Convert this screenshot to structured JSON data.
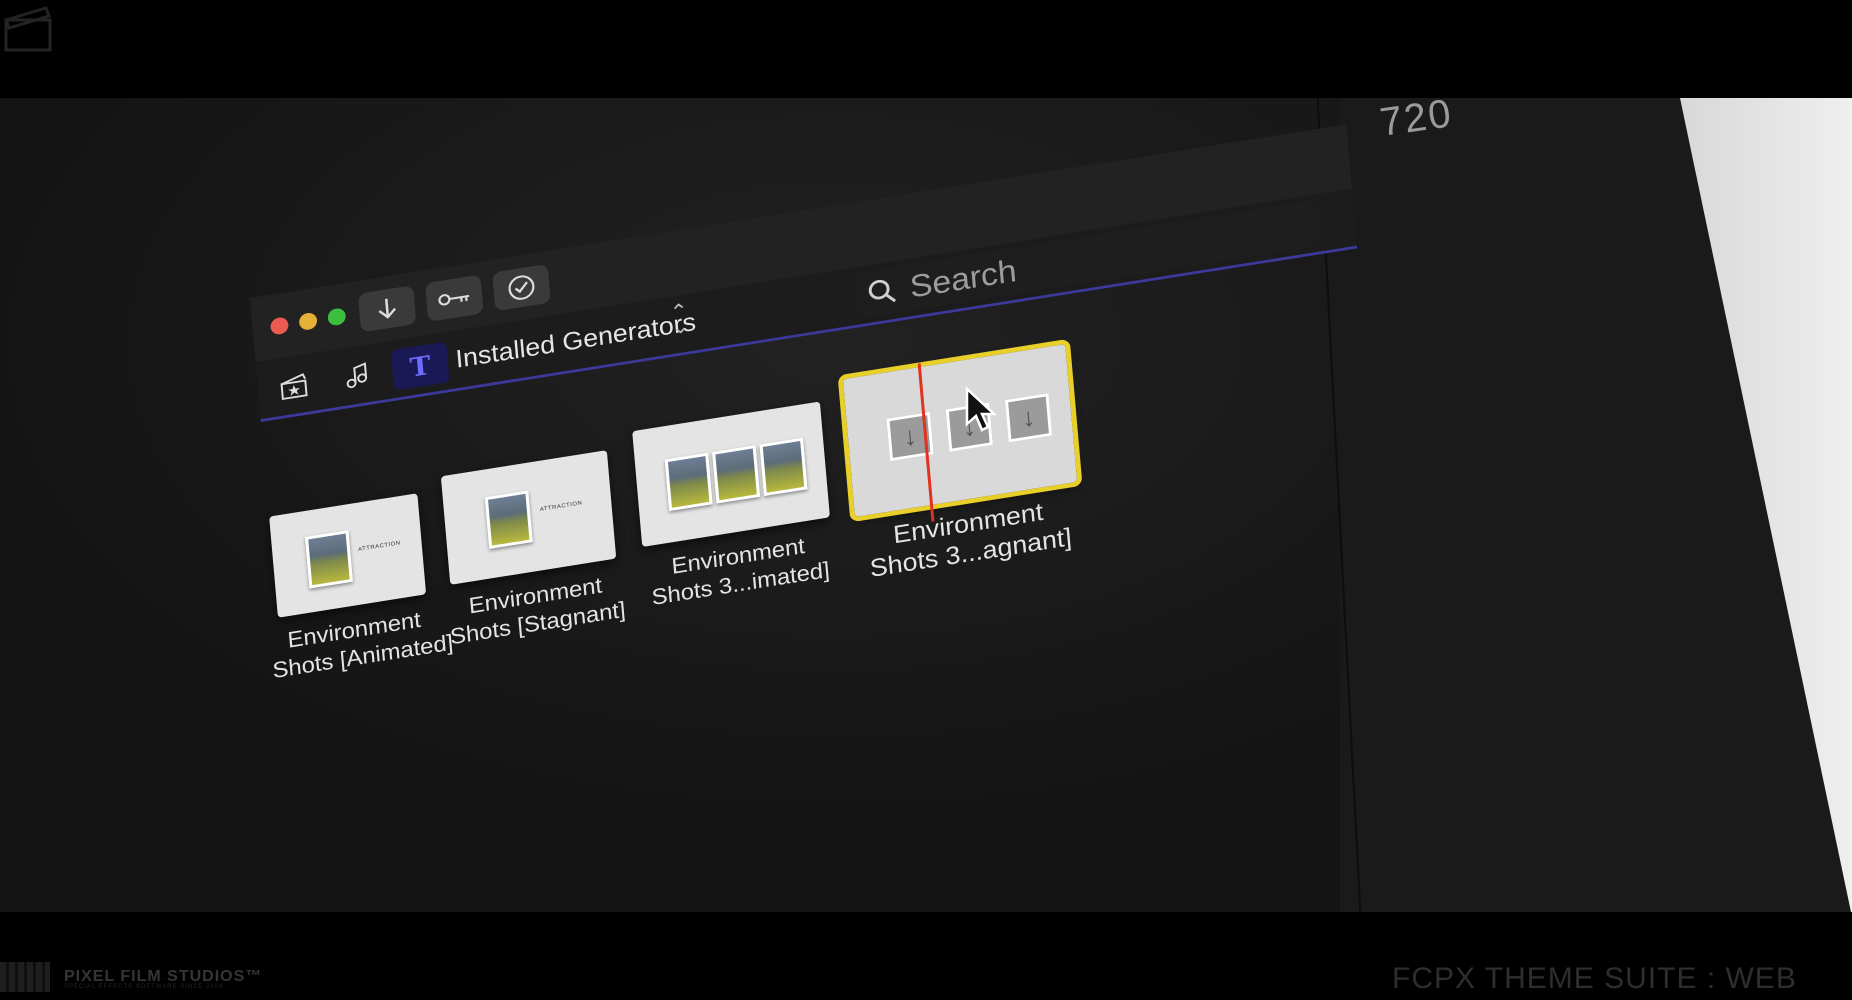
{
  "window": {
    "toolbar_buttons": [
      {
        "icon": "download-arrow-icon"
      },
      {
        "icon": "key-icon"
      },
      {
        "icon": "checkmark-circle-icon"
      }
    ],
    "tabs": [
      {
        "icon": "clapper-star-icon"
      },
      {
        "icon": "music-camera-icon"
      },
      {
        "icon": "title-generator-icon",
        "glyph": "T",
        "active": true
      }
    ],
    "generator_select": {
      "label": "Installed Generators"
    },
    "search": {
      "placeholder": "Search"
    }
  },
  "items": [
    {
      "label_line1": "Environment",
      "label_line2": "Shots [Animated]",
      "thumb_caption": "ATTRACTION",
      "selected": false
    },
    {
      "label_line1": "Environment",
      "label_line2": "Shots [Stagnant]",
      "thumb_caption": "ATTRACTION",
      "selected": false
    },
    {
      "label_line1": "Environment",
      "label_line2": "Shots 3...imated]",
      "selected": false
    },
    {
      "label_line1": "Environment",
      "label_line2": "Shots 3...agnant]",
      "selected": true
    }
  ],
  "background": {
    "right_text": "720"
  },
  "branding": {
    "logo_text": "PIXEL FILM STUDIOS™",
    "logo_sub": "SPECIAL EFFECTS SOFTWARE SINCE 2006",
    "watermark": "FCPX THEME SUITE : WEB"
  },
  "colors": {
    "accent": "#3b3a9b",
    "selection": "#e9cf2a",
    "playhead": "#e1311f"
  }
}
